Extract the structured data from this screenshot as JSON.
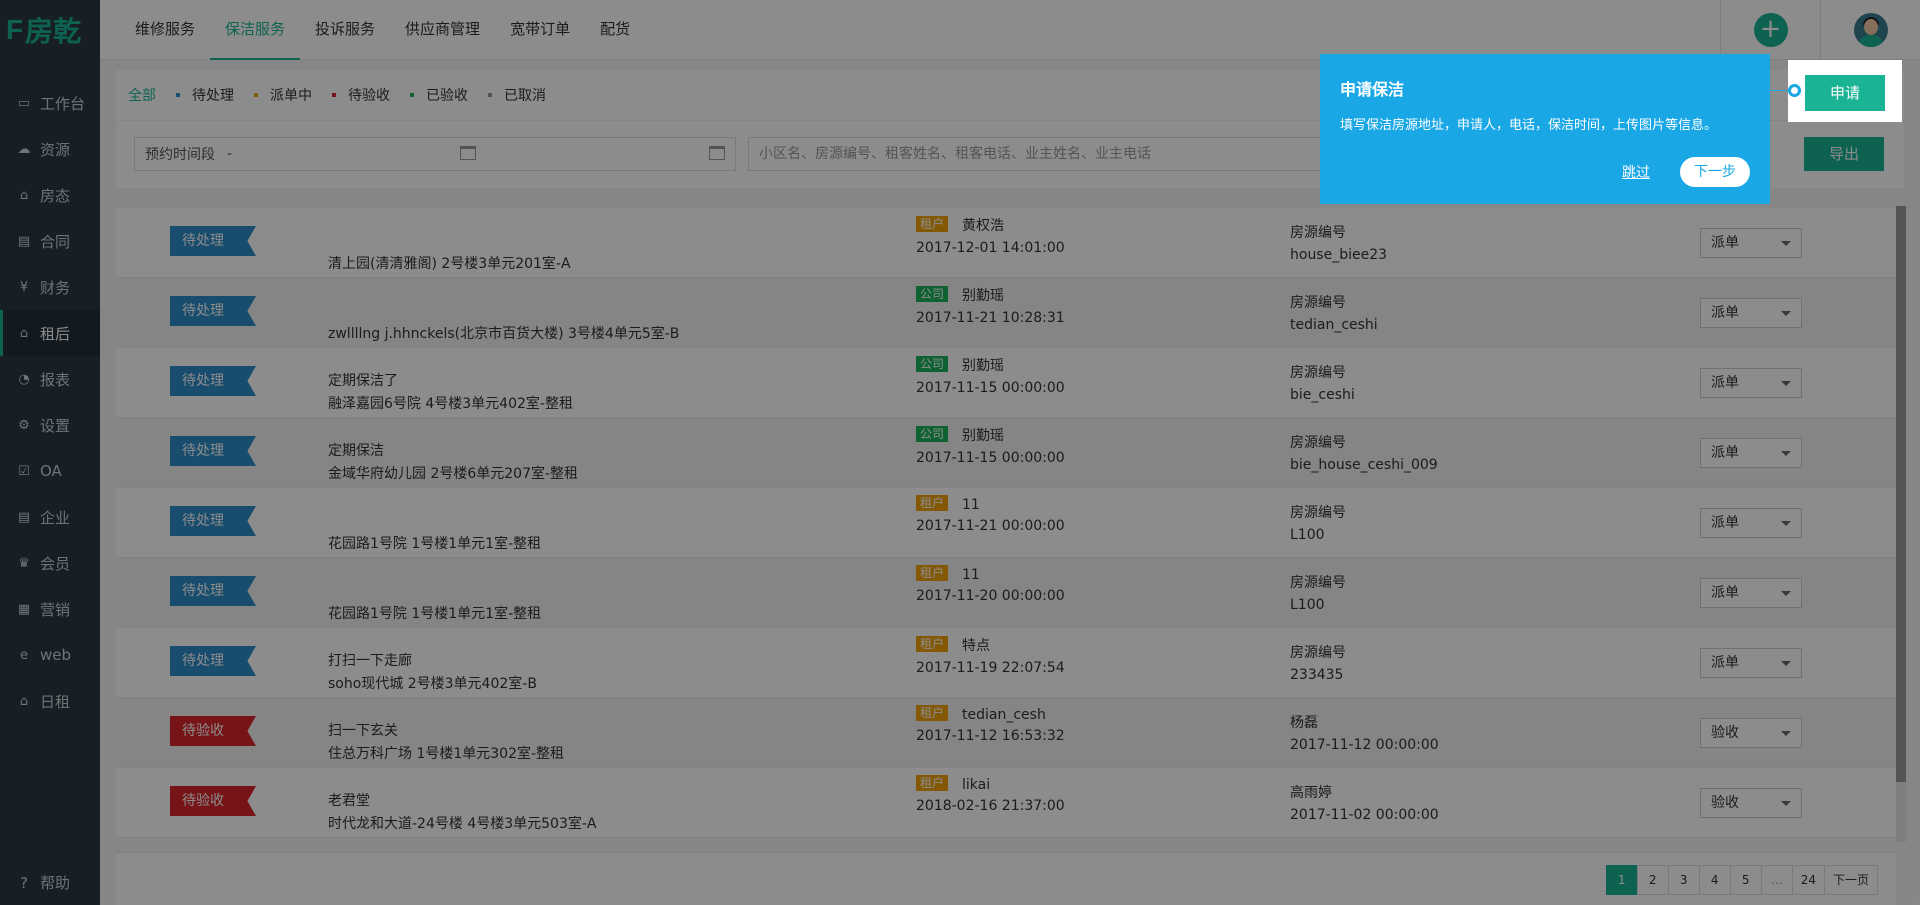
{
  "brand": {
    "logo_text": "房乾",
    "logo_letter": "F",
    "accent_color": "#1ab394"
  },
  "sidebar": {
    "items": [
      {
        "label": "工作台",
        "icon": "monitor-icon",
        "glyph": "▭"
      },
      {
        "label": "资源",
        "icon": "cloud-icon",
        "glyph": "☁"
      },
      {
        "label": "房态",
        "icon": "home-icon",
        "glyph": "⌂"
      },
      {
        "label": "合同",
        "icon": "document-icon",
        "glyph": "▤"
      },
      {
        "label": "财务",
        "icon": "yen-icon",
        "glyph": "¥"
      },
      {
        "label": "租后",
        "icon": "house-icon",
        "glyph": "⌂"
      },
      {
        "label": "报表",
        "icon": "pie-chart-icon",
        "glyph": "◔"
      },
      {
        "label": "设置",
        "icon": "gear-icon",
        "glyph": "⚙"
      },
      {
        "label": "OA",
        "icon": "checkbox-icon",
        "glyph": "☑"
      },
      {
        "label": "企业",
        "icon": "file-icon",
        "glyph": "▤"
      },
      {
        "label": "会员",
        "icon": "crown-icon",
        "glyph": "♛"
      },
      {
        "label": "营销",
        "icon": "gift-icon",
        "glyph": "▦"
      },
      {
        "label": "web",
        "icon": "edge-icon",
        "glyph": "e"
      },
      {
        "label": "日租",
        "icon": "home-icon",
        "glyph": "⌂"
      }
    ],
    "help_label": "帮助"
  },
  "top_tabs": [
    "维修服务",
    "保洁服务",
    "投诉服务",
    "供应商管理",
    "宽带订单",
    "配货"
  ],
  "status_filters": [
    {
      "label": "全部",
      "color": ""
    },
    {
      "label": "待处理",
      "color": "#2d8cc9"
    },
    {
      "label": "派单中",
      "color": "#f0a30a"
    },
    {
      "label": "待验收",
      "color": "#d9262b"
    },
    {
      "label": "已验收",
      "color": "#1ab35a"
    },
    {
      "label": "已取消",
      "color": "#999999"
    }
  ],
  "search": {
    "date_label": "预约时间段",
    "date_sep": "-",
    "placeholder": "小区名、房源编号、租客姓名、租客电话、业主姓名、业主电话",
    "export_label": "导出"
  },
  "rows": [
    {
      "status": "待处理",
      "status_color": "blue",
      "note": "",
      "address": "清上园(清清雅阁) 2号楼3单元201室-A",
      "role": "租户",
      "role_color": "orange",
      "name": "黄权浩",
      "time": "2017-12-01 14:01:00",
      "extra_label": "房源编号",
      "extra_value": "house_biee23",
      "action": "派单"
    },
    {
      "status": "待处理",
      "status_color": "blue",
      "note": "",
      "address": "zwllllng j.hhnckels(北京市百货大楼) 3号楼4单元5室-B",
      "role": "公司",
      "role_color": "green",
      "name": "别勤瑶",
      "time": "2017-11-21 10:28:31",
      "extra_label": "房源编号",
      "extra_value": "tedian_ceshi",
      "action": "派单"
    },
    {
      "status": "待处理",
      "status_color": "blue",
      "note": "定期保洁了",
      "address": "融泽嘉园6号院 4号楼3单元402室-整租",
      "role": "公司",
      "role_color": "green",
      "name": "别勤瑶",
      "time": "2017-11-15 00:00:00",
      "extra_label": "房源编号",
      "extra_value": "bie_ceshi",
      "action": "派单"
    },
    {
      "status": "待处理",
      "status_color": "blue",
      "note": "定期保洁",
      "address": "金域华府幼儿园 2号楼6单元207室-整租",
      "role": "公司",
      "role_color": "green",
      "name": "别勤瑶",
      "time": "2017-11-15 00:00:00",
      "extra_label": "房源编号",
      "extra_value": "bie_house_ceshi_009",
      "action": "派单"
    },
    {
      "status": "待处理",
      "status_color": "blue",
      "note": "",
      "address": "花园路1号院 1号楼1单元1室-整租",
      "role": "租户",
      "role_color": "orange",
      "name": "11",
      "time": "2017-11-21 00:00:00",
      "extra_label": "房源编号",
      "extra_value": "L100",
      "action": "派单"
    },
    {
      "status": "待处理",
      "status_color": "blue",
      "note": "",
      "address": "花园路1号院 1号楼1单元1室-整租",
      "role": "租户",
      "role_color": "orange",
      "name": "11",
      "time": "2017-11-20 00:00:00",
      "extra_label": "房源编号",
      "extra_value": "L100",
      "action": "派单"
    },
    {
      "status": "待处理",
      "status_color": "blue",
      "note": "打扫一下走廊",
      "address": "soho现代城 2号楼3单元402室-B",
      "role": "租户",
      "role_color": "orange",
      "name": "特点",
      "time": "2017-11-19 22:07:54",
      "extra_label": "房源编号",
      "extra_value": "233435",
      "action": "派单"
    },
    {
      "status": "待验收",
      "status_color": "red",
      "note": "扫一下玄关",
      "address": "住总万科广场 1号楼1单元302室-整租",
      "role": "租户",
      "role_color": "orange",
      "name": "tedian_cesh",
      "time": "2017-11-12 16:53:32",
      "extra_label": "杨磊",
      "extra_value": "2017-11-12 00:00:00",
      "action": "验收"
    },
    {
      "status": "待验收",
      "status_color": "red",
      "note": "老君堂",
      "address": "时代龙和大道-24号楼 4号楼3单元503室-A",
      "role": "租户",
      "role_color": "orange",
      "name": "likai",
      "time": "2018-02-16 21:37:00",
      "extra_label": "高雨婷",
      "extra_value": "2017-11-02 00:00:00",
      "action": "验收"
    }
  ],
  "pagination": [
    "1",
    "2",
    "3",
    "4",
    "5",
    "…",
    "24",
    "下一页"
  ],
  "tour": {
    "title": "申请保洁",
    "text": "填写保洁房源地址，申请人，电话，保洁时间，上传图片等信息。",
    "skip_label": "跳过",
    "next_label": "下一步",
    "highlight_button": "申请",
    "bubble_color": "#1aa7e6"
  }
}
